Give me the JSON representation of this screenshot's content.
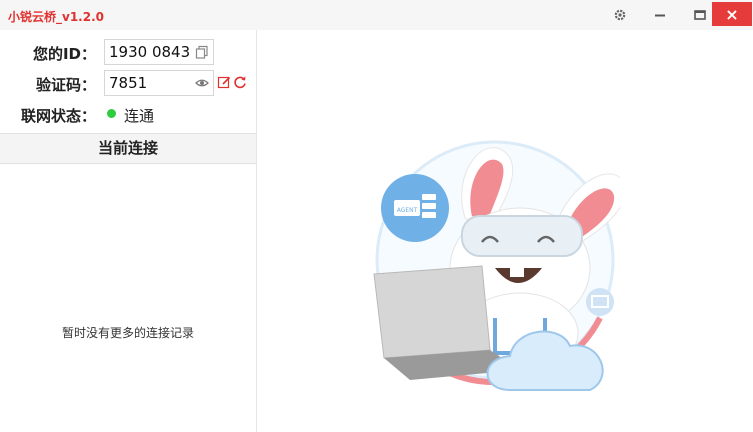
{
  "app": {
    "title": "小锐云桥_v1.2.0"
  },
  "window_controls": {
    "close": "×"
  },
  "connection": {
    "id_label": "您的ID：",
    "id_value": "1930 0843",
    "code_label": "验证码：",
    "code_value": "7851",
    "status_label": "联网状态：",
    "status_value": "连通",
    "status_color": "#2ecc40"
  },
  "history": {
    "header": "当前连接",
    "empty_message": "暂时没有更多的连接记录"
  },
  "illustration": {
    "agent_label": "AGENT"
  },
  "colors": {
    "accent": "#e0312f",
    "close_bg": "#e63b3b",
    "ring": "#f18c93",
    "cloud": "#d9ecfb"
  }
}
